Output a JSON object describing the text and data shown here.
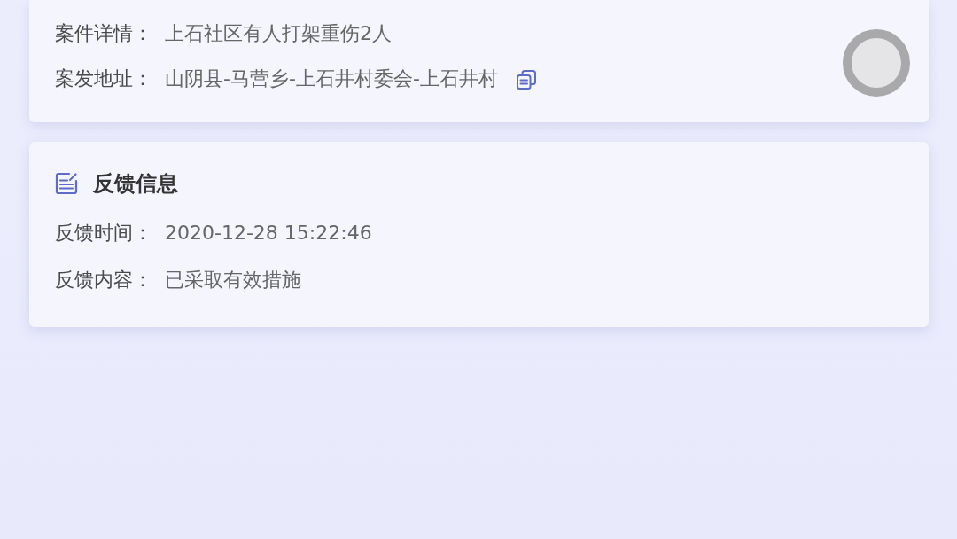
{
  "case_card": {
    "fields": [
      {
        "label": "案件详情：",
        "value": "上石社区有人打架重伤2人",
        "copyable": false
      },
      {
        "label": "案发地址：",
        "value": "山阴县-马营乡-上石井村委会-上石井村",
        "copyable": true
      }
    ]
  },
  "feedback_card": {
    "title": "反馈信息",
    "fields": [
      {
        "label": "反馈时间：",
        "value": "2020-12-28 15:22:46"
      },
      {
        "label": "反馈内容：",
        "value": "已采取有效措施"
      }
    ]
  }
}
